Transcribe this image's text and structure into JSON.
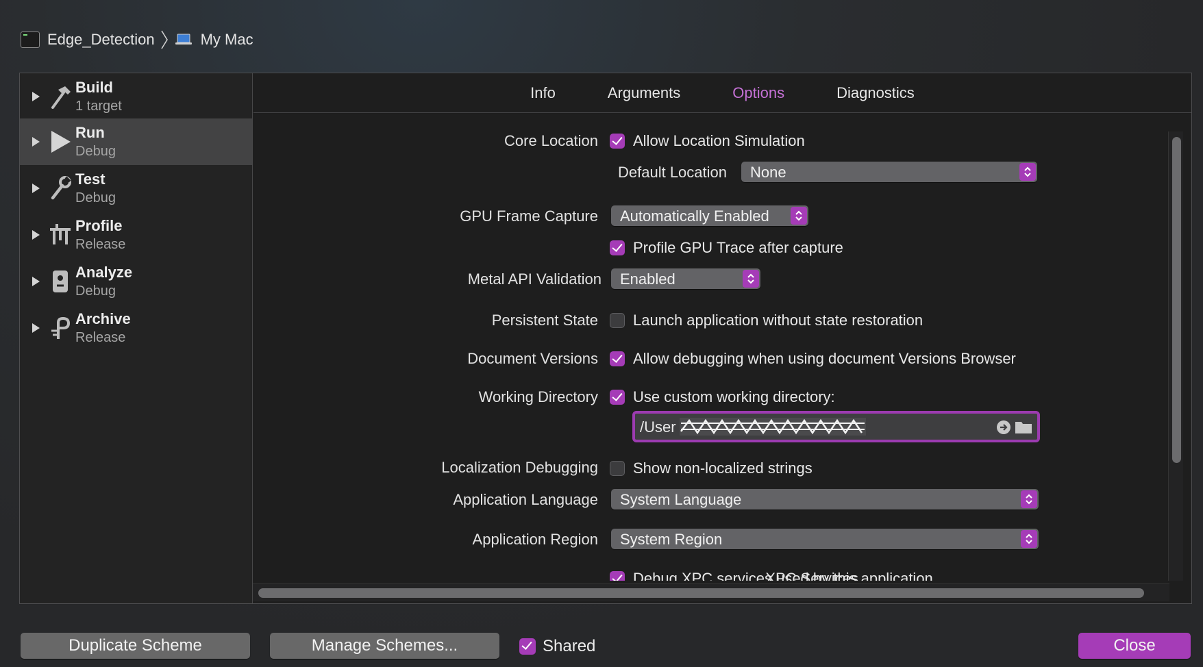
{
  "breadcrumb": {
    "scheme": "Edge_Detection",
    "destination": "My Mac"
  },
  "sidebar": {
    "items": [
      {
        "name": "Build",
        "sub": "1 target",
        "icon": "hammer-icon"
      },
      {
        "name": "Run",
        "sub": "Debug",
        "icon": "play-icon",
        "selected": true
      },
      {
        "name": "Test",
        "sub": "Debug",
        "icon": "wrench-icon"
      },
      {
        "name": "Profile",
        "sub": "Release",
        "icon": "instruments-icon"
      },
      {
        "name": "Analyze",
        "sub": "Debug",
        "icon": "analyze-icon"
      },
      {
        "name": "Archive",
        "sub": "Release",
        "icon": "archive-icon"
      }
    ]
  },
  "tabs": [
    "Info",
    "Arguments",
    "Options",
    "Diagnostics"
  ],
  "active_tab": "Options",
  "options": {
    "core_location": {
      "label": "Core Location",
      "check_label": "Allow Location Simulation",
      "checked": true
    },
    "default_location": {
      "label": "Default Location",
      "value": "None"
    },
    "gpu_frame_capture": {
      "label": "GPU Frame Capture",
      "value": "Automatically Enabled"
    },
    "profile_gpu": {
      "check_label": "Profile GPU Trace after capture",
      "checked": true
    },
    "metal_api": {
      "label": "Metal API Validation",
      "value": "Enabled"
    },
    "persistent_state": {
      "label": "Persistent State",
      "check_label": "Launch application without state restoration",
      "checked": false
    },
    "document_versions": {
      "label": "Document Versions",
      "check_label": "Allow debugging when using document Versions Browser",
      "checked": true
    },
    "working_directory": {
      "label": "Working Directory",
      "check_label": "Use custom working directory:",
      "checked": true,
      "path_visible": "/User"
    },
    "localization_debugging": {
      "label": "Localization Debugging",
      "check_label": "Show non-localized strings",
      "checked": false
    },
    "application_language": {
      "label": "Application Language",
      "value": "System Language"
    },
    "application_region": {
      "label": "Application Region",
      "value": "System Region"
    },
    "xpc_services": {
      "label": "XPC Services",
      "check_label": "Debug XPC services used by this application",
      "checked": true
    }
  },
  "footer": {
    "duplicate": "Duplicate Scheme",
    "manage": "Manage Schemes...",
    "shared": {
      "label": "Shared",
      "checked": true
    },
    "close": "Close"
  },
  "colors": {
    "accent": "#a53cb7",
    "active_tab": "#c571d6"
  }
}
